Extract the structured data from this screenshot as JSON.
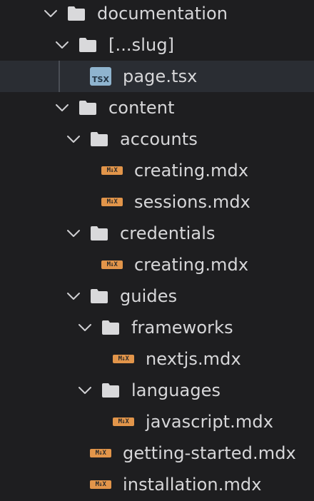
{
  "tree": [
    {
      "label": "documentation",
      "type": "folder",
      "expanded": true,
      "depth": 0
    },
    {
      "label": "[...slug]",
      "type": "folder",
      "expanded": true,
      "depth": 1
    },
    {
      "label": "page.tsx",
      "type": "file",
      "icon": "TSX",
      "depth": 2,
      "selected": true
    },
    {
      "label": "content",
      "type": "folder",
      "expanded": true,
      "depth": 1
    },
    {
      "label": "accounts",
      "type": "folder",
      "expanded": true,
      "depth": 2
    },
    {
      "label": "creating.mdx",
      "type": "file",
      "icon": "M↓X",
      "depth": 3
    },
    {
      "label": "sessions.mdx",
      "type": "file",
      "icon": "M↓X",
      "depth": 3
    },
    {
      "label": "credentials",
      "type": "folder",
      "expanded": true,
      "depth": 2
    },
    {
      "label": "creating.mdx",
      "type": "file",
      "icon": "M↓X",
      "depth": 3
    },
    {
      "label": "guides",
      "type": "folder",
      "expanded": true,
      "depth": 2
    },
    {
      "label": "frameworks",
      "type": "folder",
      "expanded": true,
      "depth": 3
    },
    {
      "label": "nextjs.mdx",
      "type": "file",
      "icon": "M↓X",
      "depth": 4
    },
    {
      "label": "languages",
      "type": "folder",
      "expanded": true,
      "depth": 3
    },
    {
      "label": "javascript.mdx",
      "type": "file",
      "icon": "M↓X",
      "depth": 4
    },
    {
      "label": "getting-started.mdx",
      "type": "file",
      "icon": "M↓X",
      "depth": 2
    },
    {
      "label": "installation.mdx",
      "type": "file",
      "icon": "M↓X",
      "depth": 2
    }
  ],
  "colors": {
    "background": "#1e1e20",
    "selected_row": "#2a2d33",
    "text": "#d7d7d9",
    "folder_icon": "#d9d9db",
    "mdx_icon": "#e2954a",
    "tsx_icon": "#8fb4cf"
  }
}
